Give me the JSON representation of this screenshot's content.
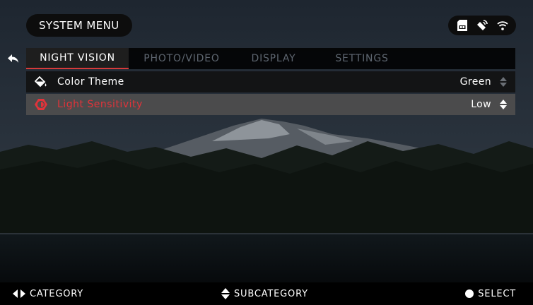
{
  "header": {
    "title": "SYSTEM MENU"
  },
  "status_icons": [
    "sd-card-icon",
    "gps-icon",
    "wifi-icon"
  ],
  "tabs": [
    {
      "label": "NIGHT VISION",
      "active": true
    },
    {
      "label": "PHOTO/VIDEO",
      "active": false
    },
    {
      "label": "DISPLAY",
      "active": false
    },
    {
      "label": "SETTINGS",
      "active": false
    }
  ],
  "settings": [
    {
      "icon": "paint-bucket-icon",
      "label": "Color Theme",
      "value": "Green",
      "selected": false
    },
    {
      "icon": "sensitivity-icon",
      "label": "Light Sensitivity",
      "value": "Low",
      "selected": true
    }
  ],
  "footer": {
    "category": "CATEGORY",
    "subcategory": "SUBCATEGORY",
    "select": "SELECT"
  },
  "colors": {
    "accent": "#d63a3a",
    "inactive_tab": "#5e6670",
    "selected_row": "#4e4e4e"
  }
}
